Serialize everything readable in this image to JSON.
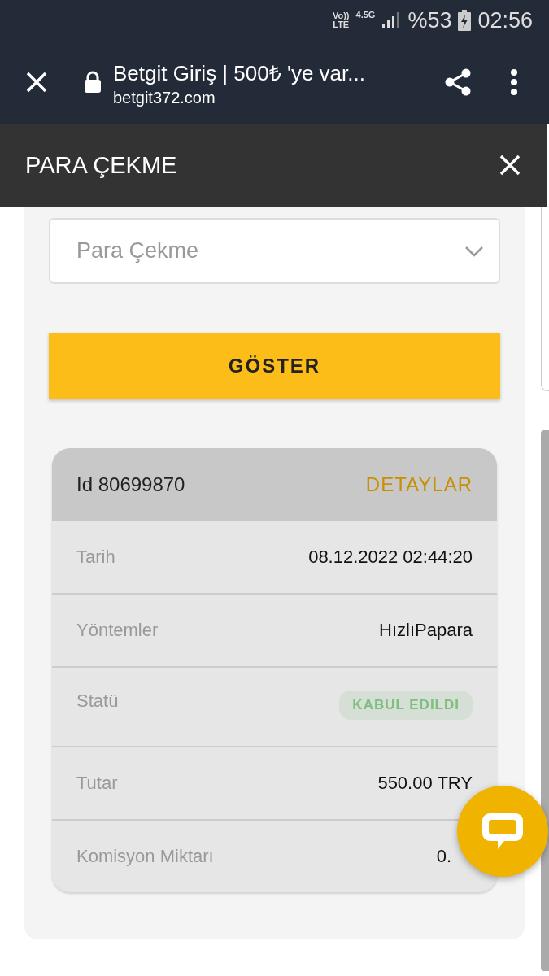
{
  "status_bar": {
    "volte": "Vo))",
    "lte": "LTE",
    "network": "4.5G",
    "battery": "%53",
    "time": "02:56"
  },
  "browser": {
    "title": "Betgit Giriş | 500₺ 'ye var...",
    "url": "betgit372.com"
  },
  "modal": {
    "title": "PARA ÇEKME"
  },
  "filter": {
    "value": "Para Çekme"
  },
  "show_button": "GÖSTER",
  "transaction": {
    "id": "Id 80699870",
    "details_link": "DETAYLAR",
    "rows": [
      {
        "kind": "text",
        "label": "Tarih",
        "value": "08.12.2022 02:44:20"
      },
      {
        "kind": "text",
        "label": "Yöntemler",
        "value": "HızlıPapara"
      },
      {
        "kind": "badge",
        "label": "Statü",
        "value": "KABUL EDILDI",
        "color": "#7dbf7d"
      },
      {
        "kind": "text",
        "label": "Tutar",
        "value": "550.00 TRY"
      },
      {
        "kind": "text",
        "label": "Komisyon Miktarı",
        "value": "0."
      }
    ]
  }
}
